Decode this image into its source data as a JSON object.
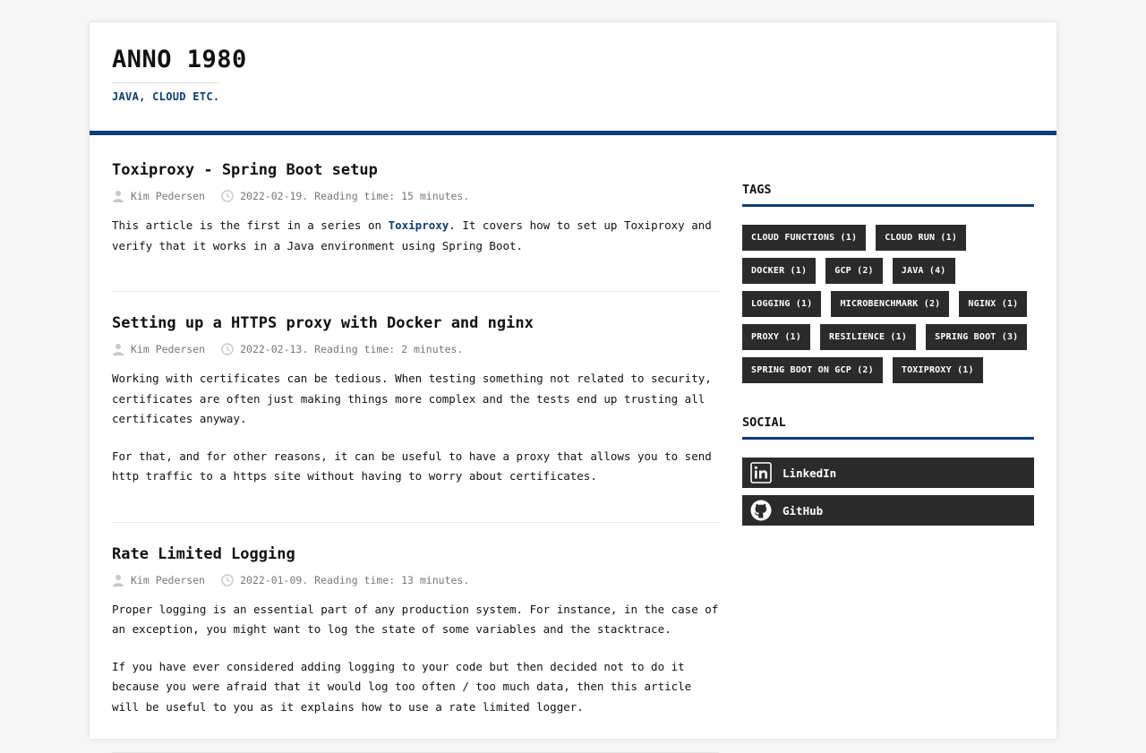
{
  "site": {
    "title": "ANNO 1980",
    "subtitle": "JAVA, CLOUD ETC."
  },
  "posts": [
    {
      "title": "Toxiproxy - Spring Boot setup",
      "author": "Kim Pedersen",
      "meta": "2022-02-19. Reading time: 15 minutes.",
      "p1_before": "This article is the first in a series on ",
      "p1_link": "Toxiproxy",
      "p1_after": ". It covers how to set up Toxiproxy and verify that it works in a Java environment using Spring Boot."
    },
    {
      "title": "Setting up a HTTPS proxy with Docker and nginx",
      "author": "Kim Pedersen",
      "meta": "2022-02-13. Reading time: 2 minutes.",
      "p1": "Working with certificates can be tedious. When testing something not related to security, certificates are often just making things more complex and the tests end up trusting all certificates anyway.",
      "p2": "For that, and for other reasons, it can be useful to have a proxy that allows you to send http traffic to a https site without having to worry about certificates."
    },
    {
      "title": "Rate Limited Logging",
      "author": "Kim Pedersen",
      "meta": "2022-01-09. Reading time: 13 minutes.",
      "p1": "Proper logging is an essential part of any production system. For instance, in the case of an exception, you might want to log the state of some variables and the stacktrace.",
      "p2": "If you have ever considered adding logging to your code but then decided not to do it because you were afraid that it would log too often / too much data, then this article will be useful to you as it explains how to use a rate limited logger."
    }
  ],
  "sidebar": {
    "tags_title": "TAGS",
    "tags": [
      "CLOUD FUNCTIONS (1)",
      "CLOUD RUN (1)",
      "DOCKER (1)",
      "GCP (2)",
      "JAVA (4)",
      "LOGGING (1)",
      "MICROBENCHMARK (2)",
      "NGINX (1)",
      "PROXY (1)",
      "RESILIENCE (1)",
      "SPRING BOOT (3)",
      "SPRING BOOT ON GCP (2)",
      "TOXIPROXY (1)"
    ],
    "social_title": "SOCIAL",
    "social": [
      {
        "label": "LinkedIn",
        "icon": "linkedin-icon"
      },
      {
        "label": "GitHub",
        "icon": "github-icon"
      }
    ]
  },
  "colors": {
    "accent": "#0d3d7a",
    "tag_bg": "#2b2b2b",
    "page_bg": "#f6f6f6"
  }
}
